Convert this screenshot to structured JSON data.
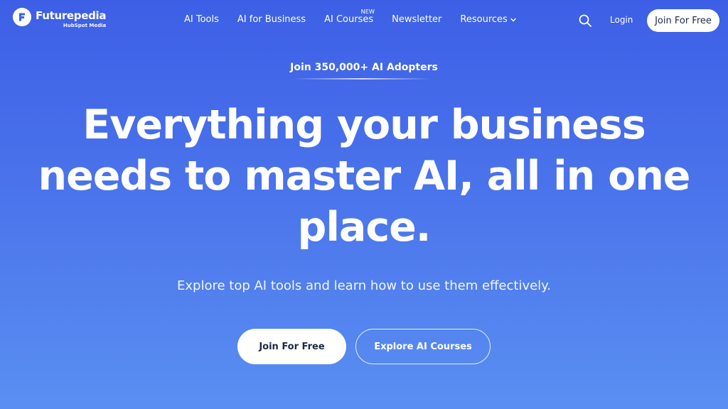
{
  "brand": {
    "name": "Futurepedia",
    "sub": "HubSpot Media",
    "logo_icon": "futurepedia-f-logo",
    "accent": "#3d5fe6"
  },
  "nav": {
    "items": [
      {
        "label": "AI Tools"
      },
      {
        "label": "AI for Business"
      },
      {
        "label": "AI Courses",
        "badge": "NEW"
      },
      {
        "label": "Newsletter"
      },
      {
        "label": "Resources",
        "icon": "chevron-down-icon"
      }
    ],
    "search_icon": "search-icon",
    "login_label": "Login",
    "join_label": "Join For Free"
  },
  "hero": {
    "adopters": "Join 350,000+ AI Adopters",
    "headline": "Everything your business needs to master AI, all in one place.",
    "subheadline": "Explore top AI tools and learn how to use them effectively.",
    "primary_cta": "Join For Free",
    "secondary_cta": "Explore AI Courses"
  }
}
